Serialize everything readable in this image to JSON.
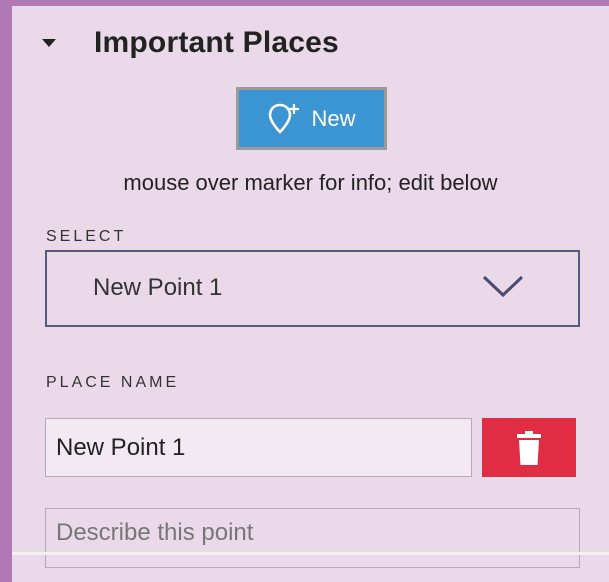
{
  "section": {
    "title": "Important Places",
    "caret_icon": "caret-down-icon"
  },
  "new_button": {
    "label": "New",
    "icon": "map-pin-plus-icon",
    "color": "#3b95d3"
  },
  "hint": "mouse over marker for info; edit below",
  "select": {
    "label": "SELECT",
    "value": "New Point 1",
    "chevron_icon": "chevron-down-icon"
  },
  "place_name": {
    "label": "PLACE NAME",
    "value": "New Point 1"
  },
  "delete_button": {
    "icon": "trash-icon",
    "color": "#e02d43"
  },
  "description": {
    "placeholder": "Describe this point",
    "value": ""
  },
  "colors": {
    "background": "#b179b3",
    "panel": "#ead9e8"
  }
}
